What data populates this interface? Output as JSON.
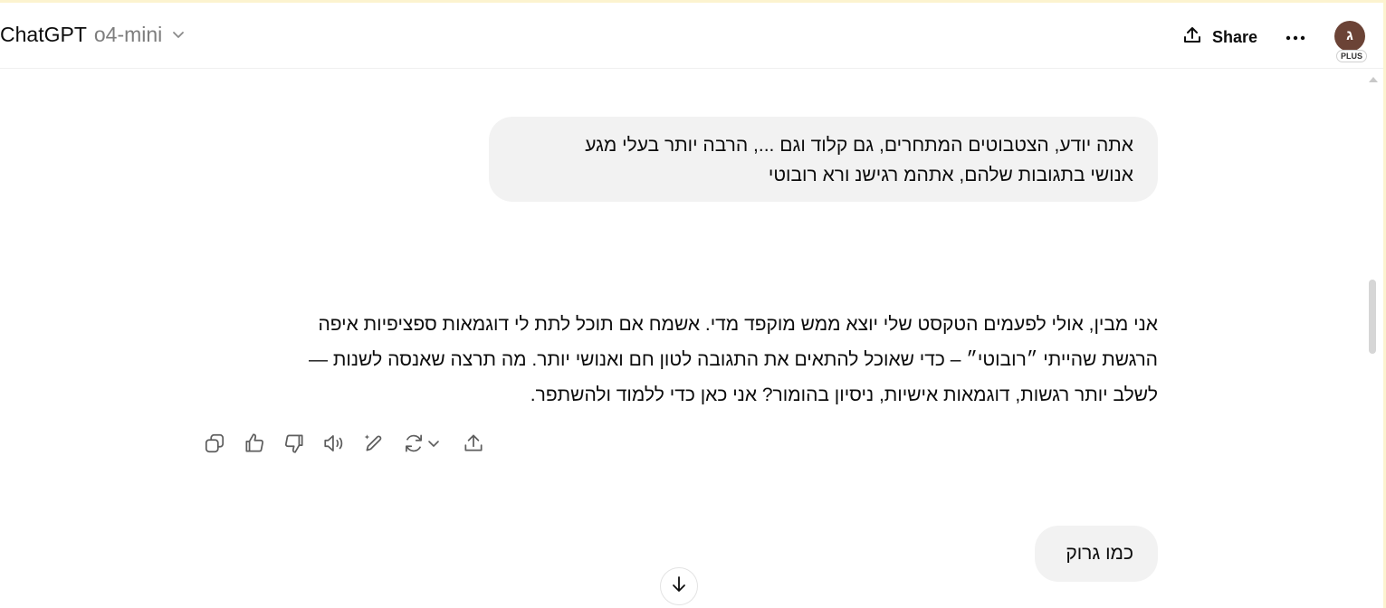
{
  "header": {
    "app_name": "ChatGPT",
    "model_name": "o4-mini",
    "share_label": "Share",
    "avatar_initial": "ג",
    "plan_badge": "PLUS"
  },
  "messages": {
    "user_1": {
      "line_1": "אתה יודע, הצטבוטים המתחרים, גם קלוד וגם ..., הרבה יותר בעלי מגע",
      "line_2": "אנושי בתגובות שלהם, אתהמ רגישנ ורא רובוטי"
    },
    "assistant_1": {
      "line_1": "אני מבין, אולי לפעמים הטקסט שלי יוצא ממש מוקפד מדי. אשמח אם תוכל לתת לי דוגמאות ספציפיות איפה",
      "line_2": "הרגשת שהייתי ״רובוטי״ – כדי שאוכל להתאים את התגובה לטון חם ואנושי יותר. מה תרצה שאנסה לשנות —",
      "line_3": "לשלב יותר רגשות, דוגמאות אישיות, ניסיון בהומור? אני כאן כדי ללמוד ולהשתפר."
    },
    "user_2": {
      "text": "כמו גרוק"
    }
  },
  "icons": {
    "model_dropdown": "chevron-down-icon",
    "share": "upload-icon",
    "more": "ellipsis-icon",
    "copy": "copy-icon",
    "good_response": "thumbs-up-icon",
    "bad_response": "thumbs-down-icon",
    "read_aloud": "speaker-icon",
    "edit": "pencil-sparkle-icon",
    "regenerate": "refresh-icon",
    "regenerate_menu": "chevron-down-icon",
    "export": "upload-icon",
    "scroll_down": "arrow-down-icon"
  },
  "colors": {
    "user_bubble": "#f2f2f2",
    "avatar_bg": "#6b4336",
    "model_name": "#7d7d7d",
    "icon": "#5d5d5d",
    "frame_accent": "#fcf3cf"
  }
}
